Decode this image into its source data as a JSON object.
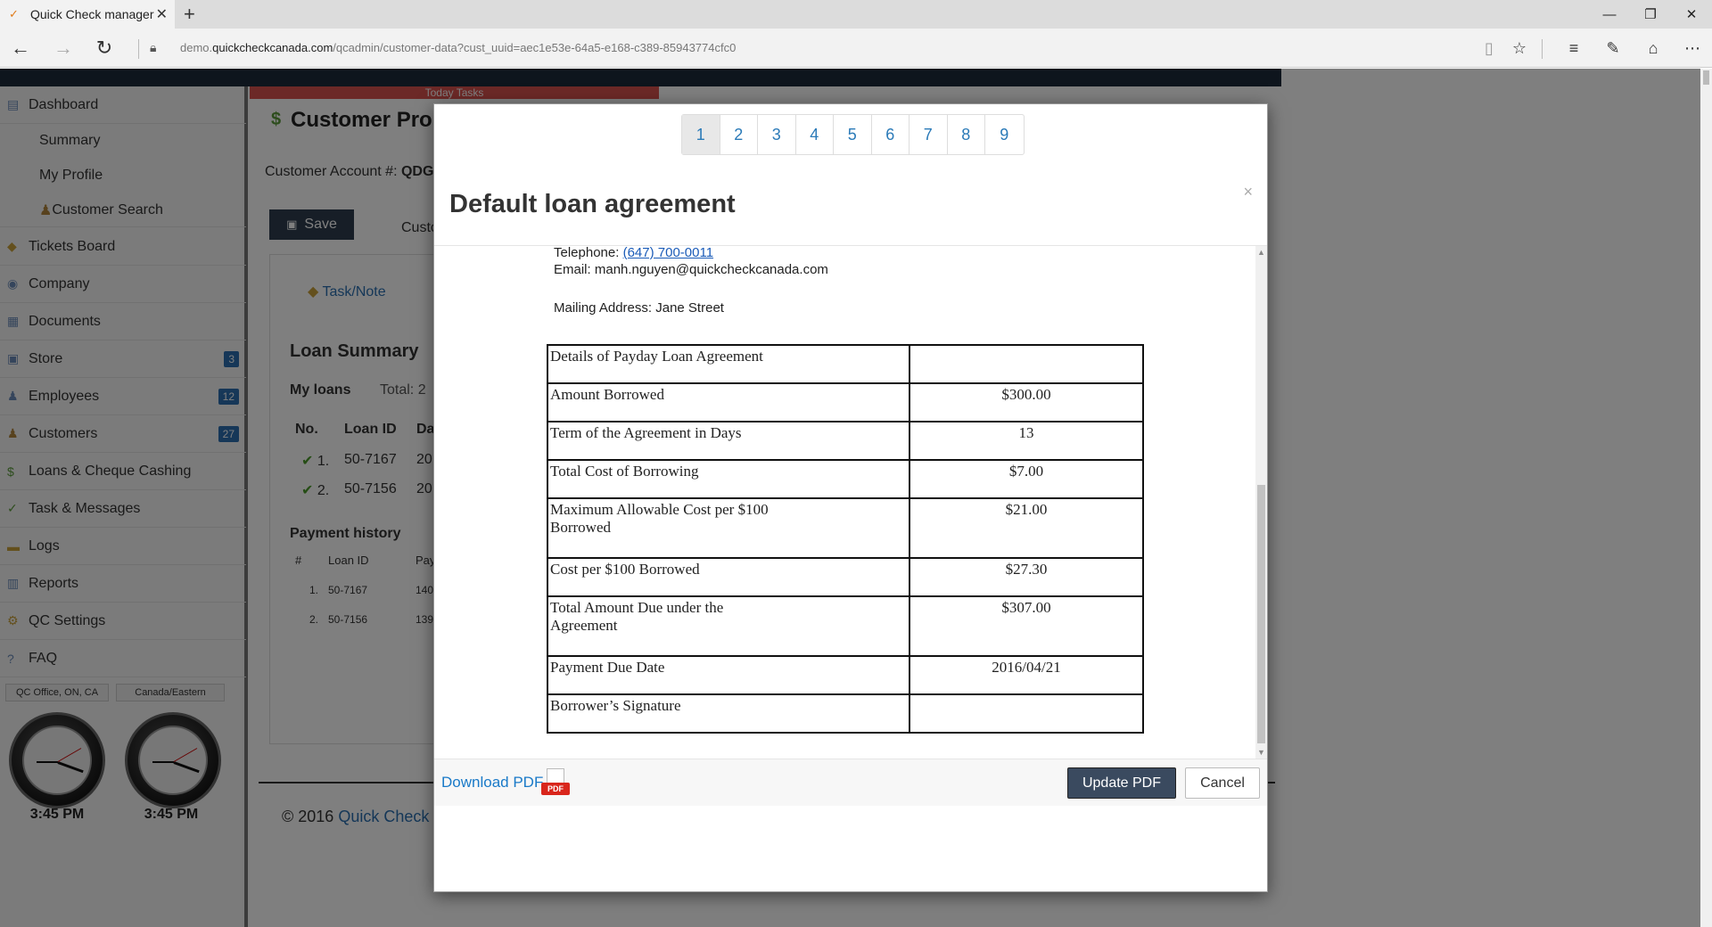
{
  "browser": {
    "tab_title": "Quick Check manager",
    "url_prefix": "demo.",
    "url_domain": "quickcheckcanada.com",
    "url_path": "/qcadmin/customer-data?cust_uuid=aec1e53e-64a5-e168-c389-85943774cfc0"
  },
  "sidebar": {
    "items": [
      {
        "label": "Dashboard"
      },
      {
        "label": "Summary"
      },
      {
        "label": "My Profile"
      },
      {
        "label": "Customer Search"
      },
      {
        "label": "Tickets Board"
      },
      {
        "label": "Company"
      },
      {
        "label": "Documents"
      },
      {
        "label": "Store",
        "badge": "3"
      },
      {
        "label": "Employees",
        "badge": "12"
      },
      {
        "label": "Customers",
        "badge": "27"
      },
      {
        "label": "Loans & Cheque Cashing"
      },
      {
        "label": "Task & Messages"
      },
      {
        "label": "Logs"
      },
      {
        "label": "Reports"
      },
      {
        "label": "QC Settings"
      },
      {
        "label": "FAQ"
      }
    ],
    "clocks": [
      {
        "zone": "QC Office, ON, CA",
        "time": "3:45 PM"
      },
      {
        "zone": "Canada/Eastern",
        "time": "3:45 PM"
      }
    ]
  },
  "main": {
    "today_tasks": "Today Tasks",
    "title": "Customer Pro",
    "account_label": "Customer Account #:",
    "account_value": "QDG",
    "save": "Save",
    "customer_tab": "Custo",
    "task_note": "Task/Note",
    "loan_summary": "Loan Summary",
    "my_loans": "My loans",
    "total": "Total: 2",
    "loan_headers": [
      "No.",
      "Loan ID",
      "Da"
    ],
    "loans": [
      {
        "no": "1.",
        "id": "50-7167",
        "date": "20"
      },
      {
        "no": "2.",
        "id": "50-7156",
        "date": "20"
      }
    ],
    "payment_history": "Payment history",
    "payment_headers": [
      "#",
      "Loan ID",
      "Pay"
    ],
    "payments": [
      {
        "no": "1.",
        "id": "50-7167",
        "val": "140"
      },
      {
        "no": "2.",
        "id": "50-7156",
        "val": "139"
      }
    ],
    "copyright_prefix": "© 2016",
    "copyright_link": "Quick Check"
  },
  "modal": {
    "pages": [
      "1",
      "2",
      "3",
      "4",
      "5",
      "6",
      "7",
      "8",
      "9"
    ],
    "active_page": "1",
    "close": "×",
    "title": "Default loan agreement",
    "telephone_label": "Telephone:",
    "telephone": "(647) 700-0011",
    "email_label": "Email:",
    "email": "manh.nguyen@quickcheckcanada.com",
    "mailing_label": "Mailing Address:",
    "mailing": "Jane Street",
    "table": [
      {
        "label": "Details of Payday Loan Agreement",
        "value": ""
      },
      {
        "label": "Amount Borrowed",
        "value": "$300.00"
      },
      {
        "label": "Term of the Agreement in Days",
        "value": "13"
      },
      {
        "label": "Total Cost of Borrowing",
        "value": "$7.00"
      },
      {
        "label": "Maximum Allowable Cost per $100 Borrowed",
        "value": "$21.00"
      },
      {
        "label": "Cost per $100 Borrowed",
        "value": "$27.30"
      },
      {
        "label": "Total Amount Due under the Agreement",
        "value": "$307.00"
      },
      {
        "label": "Payment Due Date",
        "value": "2016/04/21"
      },
      {
        "label": "Borrower’s Signature",
        "value": ""
      }
    ],
    "download_pdf": "Download PDF",
    "pdf_icon_text": "PDF",
    "update_pdf": "Update PDF",
    "cancel": "Cancel"
  }
}
